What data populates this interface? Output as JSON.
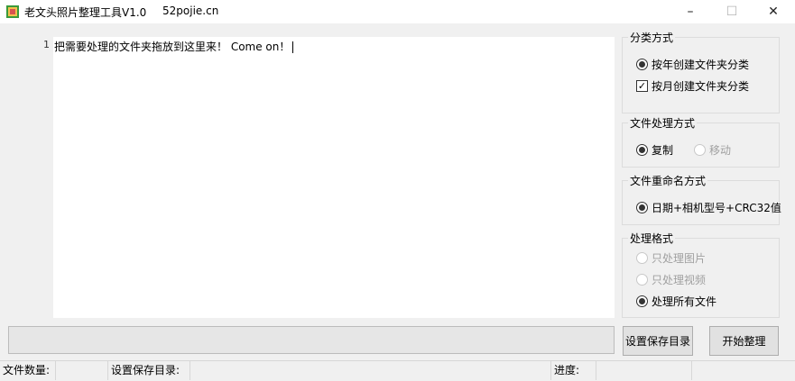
{
  "window": {
    "title": "老文头照片整理工具V1.0",
    "site": "52pojie.cn",
    "controls": {
      "minimize": "–",
      "maximize": "☐",
      "close": "✕"
    }
  },
  "editor": {
    "line_number": "1",
    "text": "把需要处理的文件夹拖放到这里来！ Come on！"
  },
  "groups": {
    "classify": {
      "title": "分类方式",
      "options": [
        {
          "label": "按年创建文件夹分类",
          "type": "radio",
          "checked": true
        },
        {
          "label": "按月创建文件夹分类",
          "type": "checkbox",
          "checked": true
        }
      ]
    },
    "file_handling": {
      "title": "文件处理方式",
      "options": [
        {
          "label": "复制",
          "type": "radio",
          "checked": true
        },
        {
          "label": "移动",
          "type": "radio",
          "checked": false,
          "disabled": true
        }
      ]
    },
    "rename": {
      "title": "文件重命名方式",
      "options": [
        {
          "label": "日期+相机型号+CRC32值",
          "type": "radio",
          "checked": true
        }
      ]
    },
    "format": {
      "title": "处理格式",
      "options": [
        {
          "label": "只处理图片",
          "type": "radio",
          "checked": false,
          "disabled": true
        },
        {
          "label": "只处理视频",
          "type": "radio",
          "checked": false,
          "disabled": true
        },
        {
          "label": "处理所有文件",
          "type": "radio",
          "checked": true
        }
      ]
    }
  },
  "progress": {
    "value": 0
  },
  "buttons": {
    "set_dir": "设置保存目录",
    "start": "开始整理"
  },
  "status": {
    "file_count": "文件数量:",
    "save_dir": "设置保存目录:",
    "progress": "进度:"
  },
  "colors": {
    "progress_fill": "#06b025",
    "background": "#f0f0f0"
  }
}
